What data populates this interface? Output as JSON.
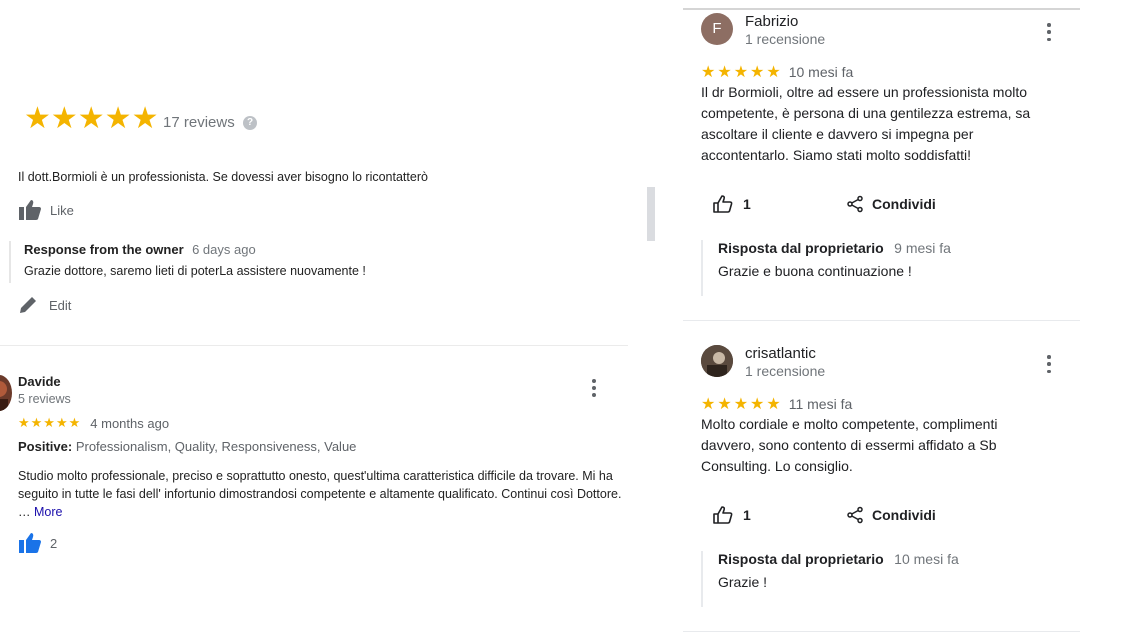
{
  "summary": {
    "stars": "★★★★★",
    "review_count": "17 reviews",
    "help_icon": "?"
  },
  "left_review": {
    "text": "Il dott.Bormioli è un professionista. Se dovessi aver bisogno lo ricontatterò",
    "like_label": "Like",
    "owner_response": {
      "title": "Response from the owner",
      "ago": "6 days ago",
      "text": "Grazie dottore, saremo lieti di poterLa assistere nuovamente !"
    },
    "edit_label": "Edit"
  },
  "davide_review": {
    "name": "Davide",
    "count": "5 reviews",
    "stars": "★★★★★",
    "ago": "4 months ago",
    "positive_label": "Positive:",
    "positive_values": "Professionalism, Quality, Responsiveness, Value",
    "text": "Studio molto professionale, preciso e soprattutto onesto, quest'ultima caratteristica difficile da trovare. Mi ha seguito in tutte le fasi dell' infortunio dimostrandosi competente e altamente qualificato. Continui così Dottore. …",
    "more_label": "More",
    "likes": "2"
  },
  "right_reviews": [
    {
      "avatar_letter": "F",
      "name": "Fabrizio",
      "count": "1 recensione",
      "stars": "★★★★★",
      "ago": "10 mesi fa",
      "text": "Il dr Bormioli, oltre ad essere un professionista molto competente, è persona di una gentilezza estrema, sa ascoltare il cliente e davvero si impegna per accontentarlo. Siamo stati molto soddisfatti!",
      "likes": "1",
      "share_label": "Condividi",
      "response_title": "Risposta dal proprietario",
      "response_ago": "9 mesi fa",
      "response_text": "Grazie e buona continuazione !"
    },
    {
      "name": "crisatlantic",
      "count": "1 recensione",
      "stars": "★★★★★",
      "ago": "11 mesi fa",
      "text": "Molto cordiale e molto competente, complimenti davvero, sono contento di essermi affidato a Sb Consulting. Lo consiglio.",
      "likes": "1",
      "share_label": "Condividi",
      "response_title": "Risposta dal proprietario",
      "response_ago": "10 mesi fa",
      "response_text": "Grazie !"
    }
  ],
  "colors": {
    "star": "#f4b400",
    "like_active": "#1a73e8",
    "link": "#1a0dab"
  }
}
